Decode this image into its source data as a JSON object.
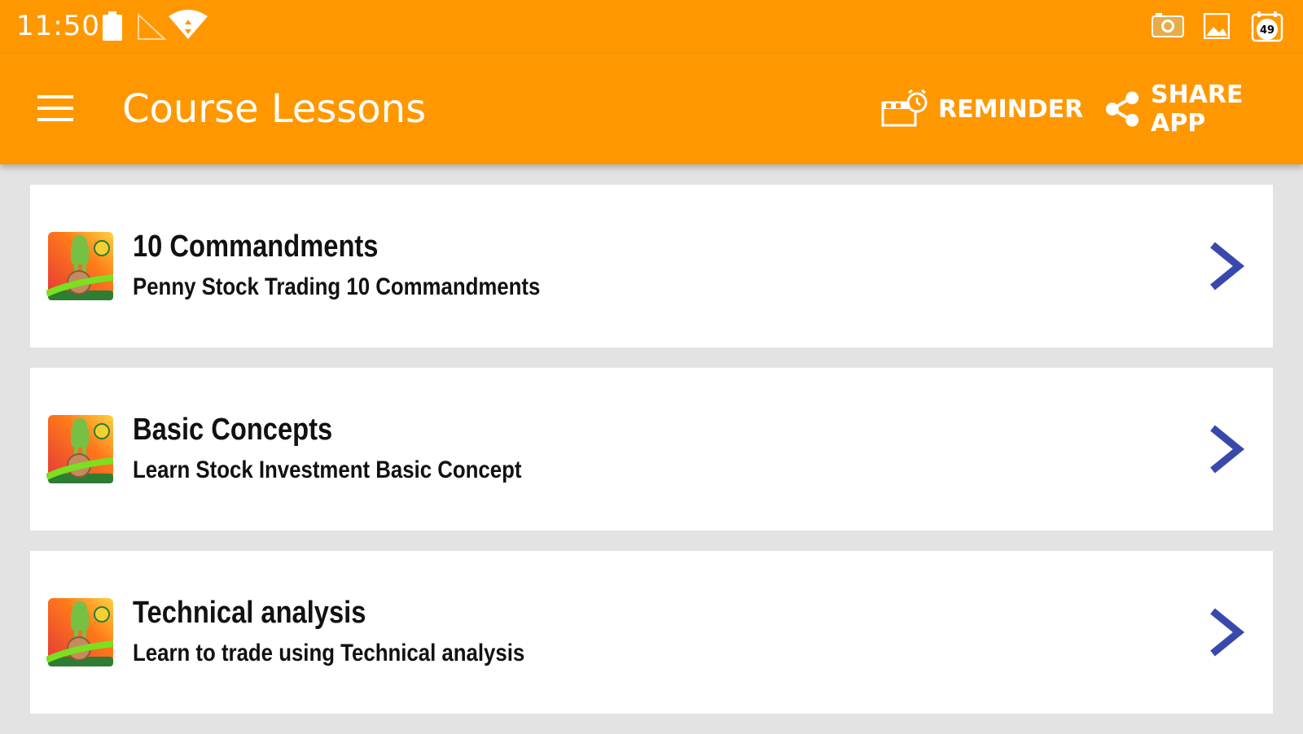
{
  "status_bar": {
    "time": "11:50",
    "notification_badge": "49",
    "icons": [
      "battery-icon",
      "no-signal-icon",
      "wifi-icon",
      "camera-notification-icon",
      "image-notification-icon",
      "calendar-notification-icon"
    ]
  },
  "app_bar": {
    "title": "Course Lessons",
    "menu_icon": "hamburger-menu-icon",
    "actions": [
      {
        "label": "REMINDER",
        "icon": "alarm-clapper-icon"
      },
      {
        "label": "SHARE APP",
        "icon": "share-icon"
      }
    ]
  },
  "lessons": [
    {
      "title": "10 Commandments",
      "subtitle": "Penny Stock Trading 10 Commandments",
      "icon": "course-thumbnail-icon"
    },
    {
      "title": "Basic Concepts",
      "subtitle": "Learn Stock Investment Basic Concept",
      "icon": "course-thumbnail-icon"
    },
    {
      "title": "Technical analysis",
      "subtitle": "Learn to trade using Technical analysis",
      "icon": "course-thumbnail-icon"
    }
  ],
  "colors": {
    "primary": "#ff9800",
    "background": "#e3e3e3",
    "card": "#ffffff",
    "chevron": "#3949ab",
    "text": "#111111"
  }
}
